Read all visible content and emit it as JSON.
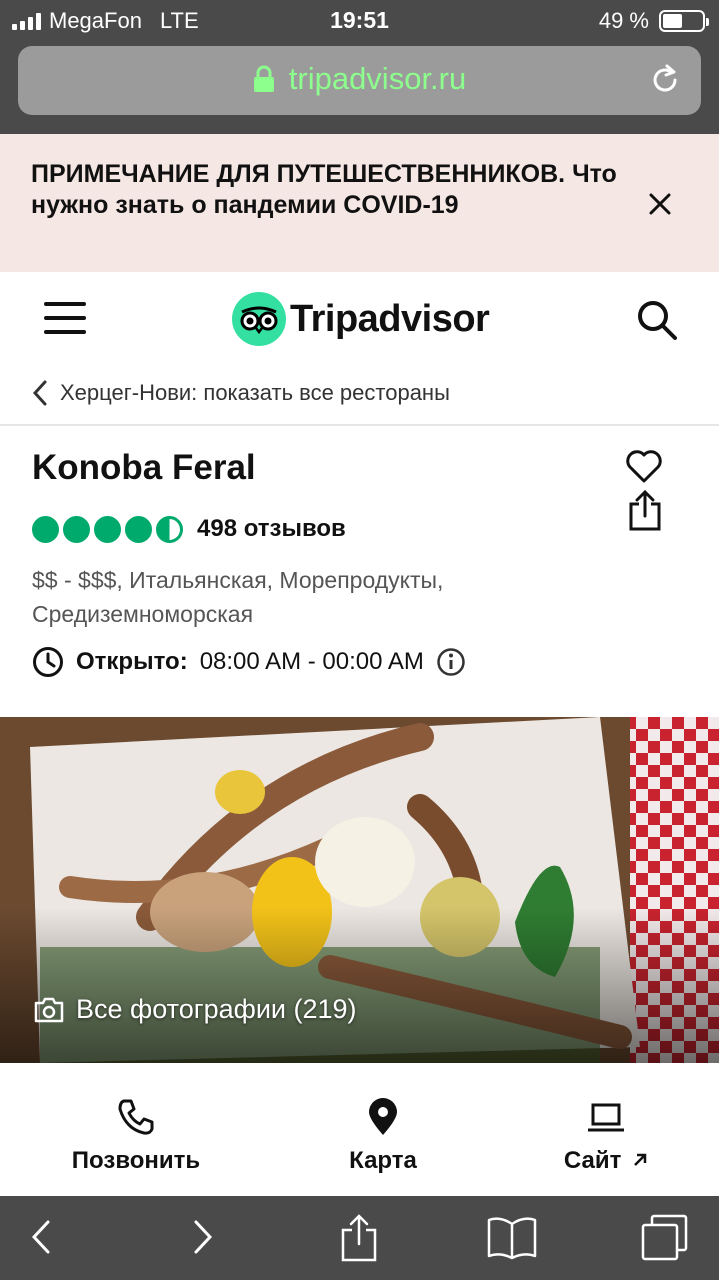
{
  "status_bar": {
    "carrier": "MegaFon",
    "network": "LTE",
    "time": "19:51",
    "battery": "49 %",
    "battery_level": 0.49
  },
  "browser": {
    "url": "tripadvisor.ru"
  },
  "banner": {
    "bold": "ПРИМЕЧАНИЕ ДЛЯ ПУТЕШЕСТВЕННИКОВ.",
    "text": " Что нужно знать о пандемии COVID-19"
  },
  "header": {
    "logo_text": "Tripadvisor"
  },
  "breadcrumb": {
    "label": "Херцег-Нови: показать все рестораны"
  },
  "restaurant": {
    "name": "Konoba Feral",
    "rating": 4.5,
    "reviews": "498 отзывов",
    "cuisine": "$$ - $$$, Итальянская, Морепродукты, Средиземноморская",
    "hours_label": "Открыто:",
    "hours_value": "08:00 AM - 00:00 AM"
  },
  "photo": {
    "label": "Все фотографии (219)"
  },
  "actions": {
    "call": "Позвонить",
    "map": "Карта",
    "site": "Сайт"
  },
  "colors": {
    "brand_green": "#00aa6c",
    "banner_bg": "#f5e7e3",
    "chrome_dark": "#4a4a4a"
  }
}
